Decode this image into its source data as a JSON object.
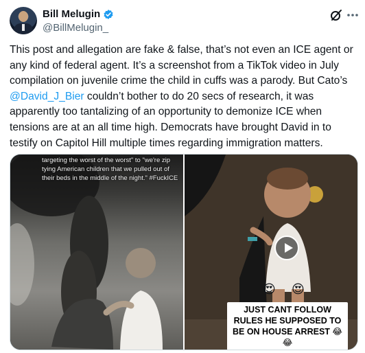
{
  "post": {
    "author": {
      "display_name": "Bill Melugin",
      "handle": "@BillMelugin_",
      "verified": true
    },
    "actions": [
      "grok-icon",
      "more-options-icon"
    ],
    "text": {
      "before_mention": "This post and allegation are fake & false, that’s not even an ICE agent or any kind of federal agent. It’s a screenshot from a TikTok video in July compilation on juvenile crime the child in cuffs was a parody. But Cato’s ",
      "mention": "@David_J_Bier",
      "after_mention": " couldn’t bother to do 20 secs of research, it was apparently too tantalizing of an opportunity to demonize ICE when tensions are at an all time high. Democrats have brought David in to testify on Capitol Hill multiple times regarding immigration matters."
    },
    "media": {
      "left_caption": "targeting the worst of the worst\" to \"we're zip tying American children that we pulled out of their beds in the middle of the night.\" #FuckICE",
      "right_banner": "JUST CANT FOLLOW RULES HE SUPPOSED TO BE ON HOUSE ARREST 😂😂",
      "right_emojis": [
        "😍",
        "😍"
      ]
    }
  },
  "colors": {
    "accent": "#1d9bf0",
    "text": "#0f1419",
    "secondary": "#536471"
  }
}
